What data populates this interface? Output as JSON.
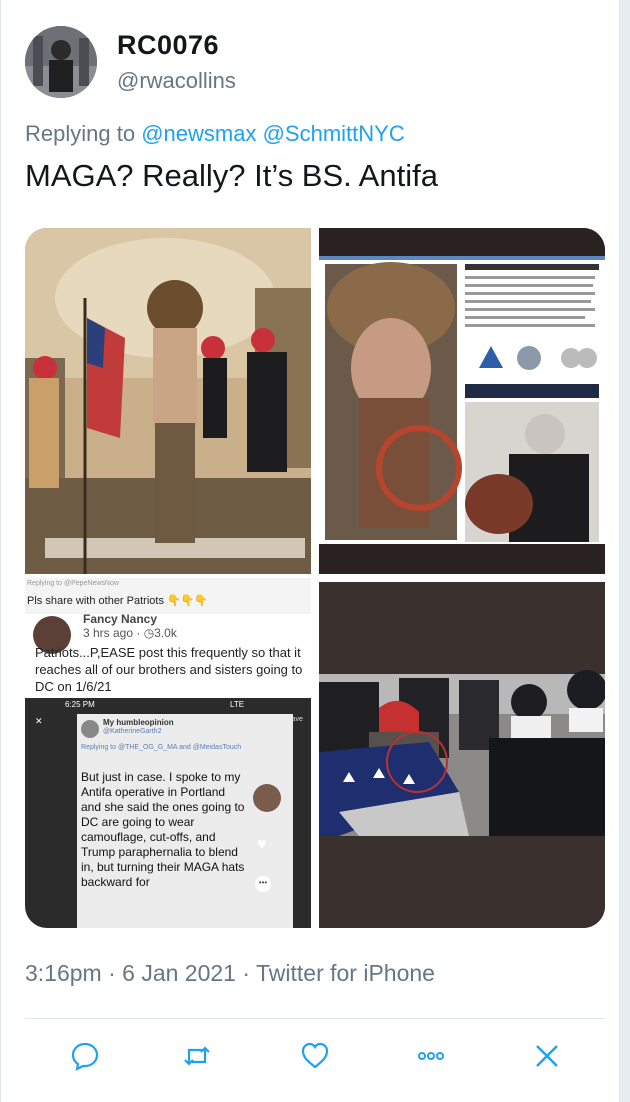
{
  "tweet": {
    "display_name": "RC0076",
    "handle": "@rwacollins",
    "replying_prefix": "Replying to",
    "replying_to": [
      "@newsmax",
      "@SchmittNYC"
    ],
    "text": "MAGA? Really? It’s BS. Antifa",
    "timestamp": "3:16pm · 6 Jan 2021 · Twitter for iPhone"
  },
  "media": {
    "panel3": {
      "reply_line": "Replying to @PepeNewsNow",
      "share_text": "Pls share with other Patriots",
      "poster": "Fancy Nancy",
      "age": "3 hrs ago · ◷3.0k",
      "post_text": "Patriots...P,EASE post this frequently so that it reaches all of our brothers and sisters going to DC on 1/6/21",
      "phone_time": "6:25 PM",
      "phone_status": "LTE",
      "save_label": "Save",
      "inner_user": "My humbleopinion",
      "inner_handle": "@KatherineGarth2",
      "inner_reply": "Replying to @THE_OG_G_MA and @MeidasTouch",
      "inner_text": "But just in case. I spoke to my Antifa operative in Portland and she said the ones going to DC are going to wear camouflage, cut-offs, and Trump paraphernalia to blend in, but turning their MAGA hats backward for"
    }
  },
  "actions": {
    "icons": [
      "reply-icon",
      "retweet-icon",
      "like-icon",
      "more-icon",
      "close-icon"
    ]
  },
  "colors": {
    "accent": "#1da1f2",
    "text": "#14171a",
    "secondary": "#657786"
  }
}
